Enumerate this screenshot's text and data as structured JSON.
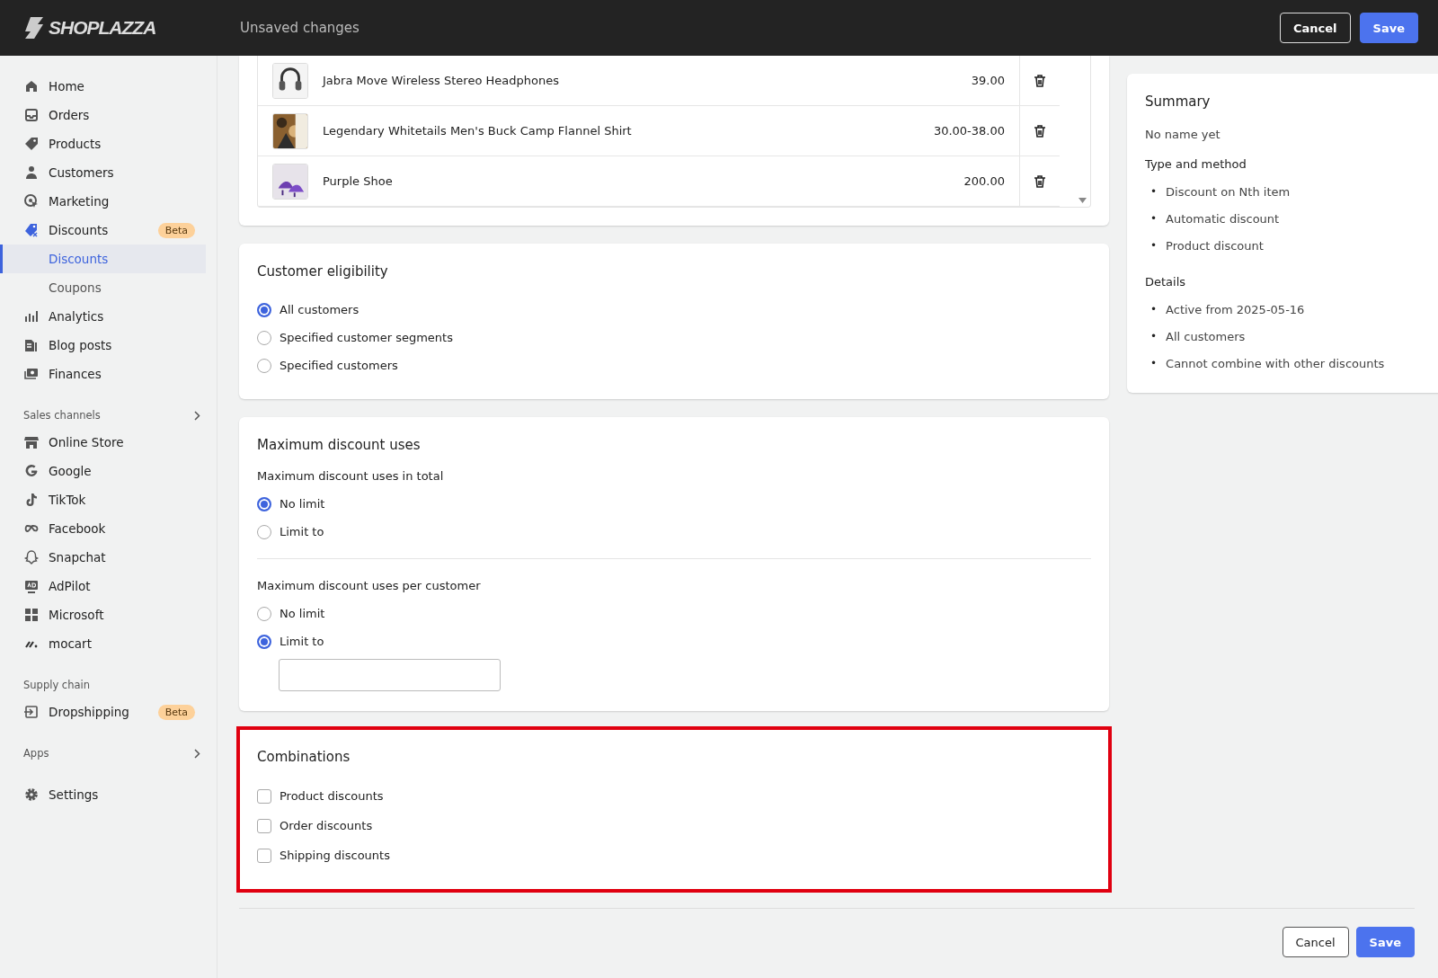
{
  "topbar": {
    "logo": "SHOPLAZZA",
    "title": "Unsaved changes",
    "buttons": [
      {
        "label": "Cancel",
        "kind": "secondary"
      },
      {
        "label": "Save",
        "kind": "primary"
      }
    ]
  },
  "sidebar": {
    "sections": [
      {
        "items": [
          {
            "label": "Home"
          },
          {
            "label": "Orders"
          },
          {
            "label": "Products"
          },
          {
            "label": "Customers"
          },
          {
            "label": "Marketing"
          },
          {
            "label": "Discounts",
            "badge": "Beta",
            "children": [
              {
                "label": "Discounts",
                "selected": true
              },
              {
                "label": "Coupons",
                "selected": false
              }
            ]
          },
          {
            "label": "Analytics"
          },
          {
            "label": "Blog posts"
          },
          {
            "label": "Finances"
          }
        ]
      },
      {
        "title": "Sales channels",
        "chevron": true,
        "items": [
          {
            "label": "Online Store"
          },
          {
            "label": "Google"
          },
          {
            "label": "TikTok"
          },
          {
            "label": "Facebook"
          },
          {
            "label": "Snapchat"
          },
          {
            "label": "AdPilot"
          },
          {
            "label": "Microsoft"
          },
          {
            "label": "mocart"
          }
        ]
      },
      {
        "title": "Supply chain",
        "chevron": false,
        "items": [
          {
            "label": "Dropshipping",
            "badge": "Beta"
          }
        ]
      },
      {
        "title": "Apps",
        "chevron": true
      },
      {
        "items": [
          {
            "label": "Settings"
          }
        ]
      }
    ]
  },
  "products": [
    {
      "name": "Jabra Move Wireless Stereo Headphones",
      "price": "39.00",
      "kind": "picture"
    },
    {
      "name": "Legendary Whitetails Men's Buck Camp Flannel Shirt",
      "price": "30.00-38.00",
      "kind": "picture"
    },
    {
      "name": "Purple Shoe",
      "price": "200.00",
      "kind": "picture"
    }
  ],
  "eligibility": {
    "title": "Customer eligibility",
    "options": [
      {
        "label": "All customers",
        "selected": true
      },
      {
        "label": "Specified customer segments",
        "selected": false
      },
      {
        "label": "Specified customers",
        "selected": false
      }
    ]
  },
  "max_uses": {
    "title": "Maximum discount uses",
    "groups": [
      {
        "label": "Maximum discount uses in total",
        "show_field": false,
        "options": [
          {
            "label": "No limit",
            "selected": true
          },
          {
            "label": "Limit to",
            "selected": false
          }
        ]
      },
      {
        "label": "Maximum discount uses per customer",
        "show_field": true,
        "options": [
          {
            "label": "No limit",
            "selected": false
          },
          {
            "label": "Limit to",
            "selected": true
          }
        ]
      }
    ]
  },
  "combinations": {
    "title": "Combinations",
    "highlighted": true,
    "options": [
      {
        "label": "Product discounts",
        "checked": false
      },
      {
        "label": "Order discounts",
        "checked": false
      },
      {
        "label": "Shipping discounts",
        "checked": false
      }
    ]
  },
  "summary": {
    "title": "Summary",
    "name": "No name yet",
    "sections": [
      {
        "title": "Type and method",
        "items": [
          {
            "bullet": "•",
            "text": "Discount on Nth item"
          },
          {
            "bullet": "•",
            "text": "Automatic discount"
          },
          {
            "bullet": "•",
            "text": "Product discount"
          }
        ]
      },
      {
        "title": "Details",
        "items": [
          {
            "bullet": "•",
            "text": "Active from 2025-05-16"
          },
          {
            "bullet": "•",
            "text": "All customers"
          },
          {
            "bullet": "•",
            "text": "Cannot combine with other discounts"
          }
        ]
      }
    ]
  },
  "footer": {
    "buttons": [
      {
        "label": "Cancel",
        "kind": "secondary"
      },
      {
        "label": "Save",
        "kind": "primary"
      }
    ]
  }
}
